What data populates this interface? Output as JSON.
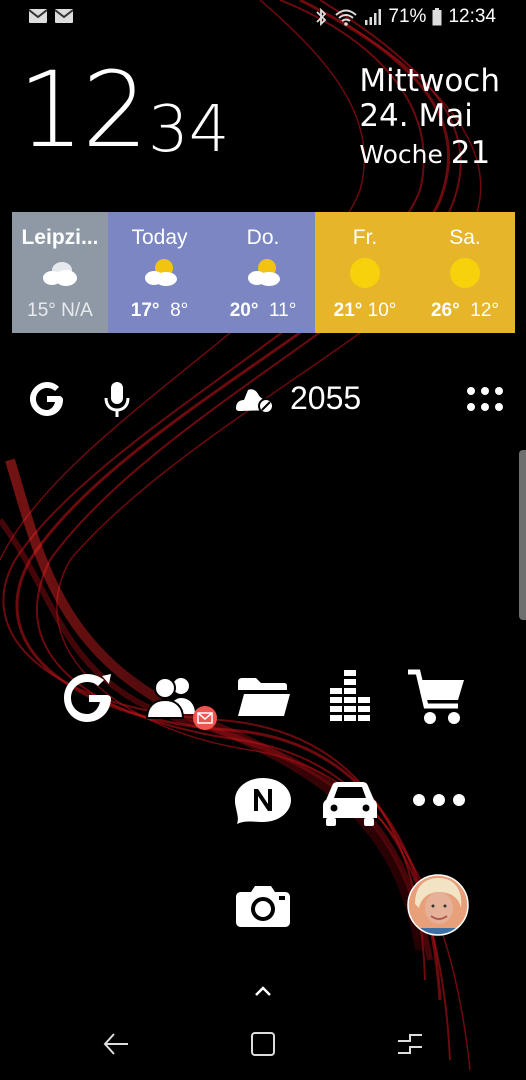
{
  "status_bar": {
    "battery": "71%",
    "time": "12:34",
    "left_icons": [
      "mail-icon",
      "mail-icon"
    ],
    "right_icons": [
      "bluetooth-icon",
      "wifi-icon",
      "signal-icon",
      "battery-icon"
    ]
  },
  "clock": {
    "hour": "12",
    "minute": "34"
  },
  "date": {
    "weekday": "Mittwoch",
    "day_month": "24. Mai",
    "week_label": "Woche",
    "week_number": "21"
  },
  "weather": {
    "days": [
      {
        "label": "Leipzi...",
        "icon": "cloudy-icon",
        "high": "15°",
        "low": "N/A",
        "color": "#8f99a6"
      },
      {
        "label": "Today",
        "icon": "partly-cloudy-icon",
        "high": "17°",
        "low": "8°",
        "color": "#7b86c2"
      },
      {
        "label": "Do.",
        "icon": "partly-cloudy-icon",
        "high": "20°",
        "low": "11°",
        "color": "#7b86c2"
      },
      {
        "label": "Fr.",
        "icon": "sun-icon",
        "high": "21°",
        "low": "10°",
        "color": "#e6b52a"
      },
      {
        "label": "Sa.",
        "icon": "sun-icon",
        "high": "26°",
        "low": "12°",
        "color": "#e6b52a"
      }
    ]
  },
  "search_row": {
    "step_count": "2055",
    "icons": [
      "google-icon",
      "microphone-icon",
      "shoe-steps-icon",
      "app-drawer-icon"
    ]
  },
  "apps_row1": [
    "google-refresh-icon",
    "contacts-icon",
    "folder-icon",
    "equalizer-icon",
    "shopping-cart-icon"
  ],
  "contacts_badge_icon": "email-badge-icon",
  "apps_row2": [
    "notes-n-icon",
    "car-icon",
    "more-dots-icon"
  ],
  "apps_row3": [
    "camera-icon",
    "avatar"
  ],
  "nav": {
    "icons": [
      "up-chevron-icon",
      "back-icon",
      "home-icon",
      "recents-icon"
    ]
  },
  "colors": {
    "weather_gray": "#8f99a6",
    "weather_blue": "#7b86c2",
    "weather_yellow": "#e6b52a",
    "sun": "#f2c40f",
    "badge": "#f0544f",
    "wallpaper_red": "#c4121a"
  }
}
